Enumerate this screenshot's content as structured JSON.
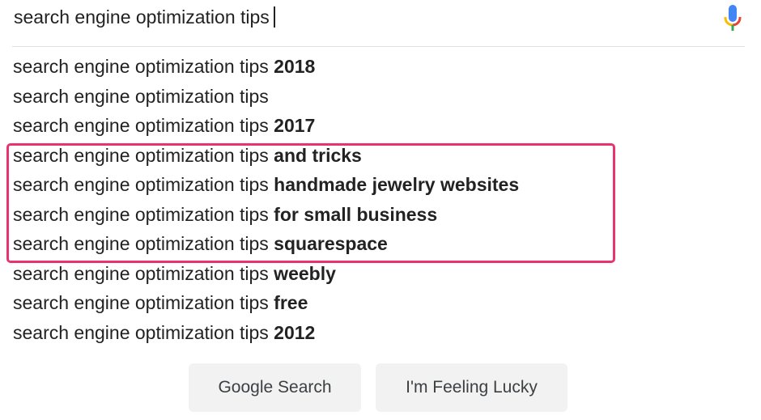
{
  "search": {
    "query": "search engine optimization tips"
  },
  "suggestions": [
    {
      "prefix": "search engine optimization tips",
      "completion": " 2018"
    },
    {
      "prefix": "search engine optimization tips",
      "completion": ""
    },
    {
      "prefix": "search engine optimization tips",
      "completion": " 2017"
    },
    {
      "prefix": "search engine optimization tips",
      "completion": " and tricks"
    },
    {
      "prefix": "search engine optimization tips",
      "completion": " handmade jewelry websites"
    },
    {
      "prefix": "search engine optimization tips",
      "completion": " for small business"
    },
    {
      "prefix": "search engine optimization tips",
      "completion": " squarespace"
    },
    {
      "prefix": "search engine optimization tips",
      "completion": " weebly"
    },
    {
      "prefix": "search engine optimization tips",
      "completion": " free"
    },
    {
      "prefix": "search engine optimization tips",
      "completion": " 2012"
    }
  ],
  "buttons": {
    "search_label": "Google Search",
    "lucky_label": "I'm Feeling Lucky"
  },
  "colors": {
    "highlight": "#e8336f",
    "mic_blue": "#4285f4",
    "mic_red": "#ea4335",
    "mic_yellow": "#fbbc04",
    "mic_green": "#34a853",
    "button_bg": "#f2f2f2"
  },
  "icons": {
    "mic": "microphone-icon"
  }
}
